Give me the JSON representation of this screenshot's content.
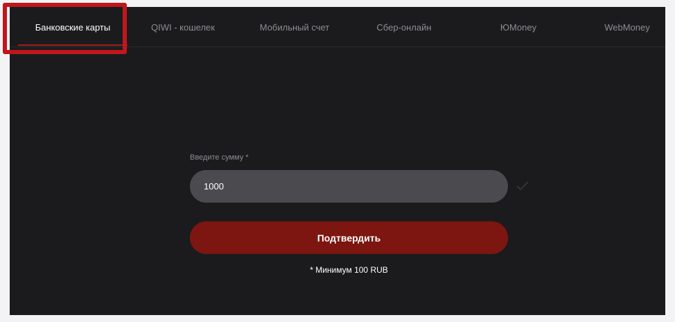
{
  "tabs": [
    {
      "label": "Банковские карты",
      "active": true
    },
    {
      "label": "QIWI - кошелек",
      "active": false
    },
    {
      "label": "Мобильный счет",
      "active": false
    },
    {
      "label": "Сбер-онлайн",
      "active": false
    },
    {
      "label": "ЮMoney",
      "active": false
    },
    {
      "label": "WebMoney",
      "active": false
    }
  ],
  "form": {
    "amount_label": "Введите сумму *",
    "amount_value": "1000",
    "confirm_label": "Подтвердить",
    "min_note": "* Минимум 100 RUB"
  },
  "icons": {
    "input_status": "check-icon"
  },
  "colors": {
    "panel_bg": "#1b1b1d",
    "accent": "#7d1610",
    "highlight": "#c0161d",
    "input_bg": "#4a4a4f"
  }
}
